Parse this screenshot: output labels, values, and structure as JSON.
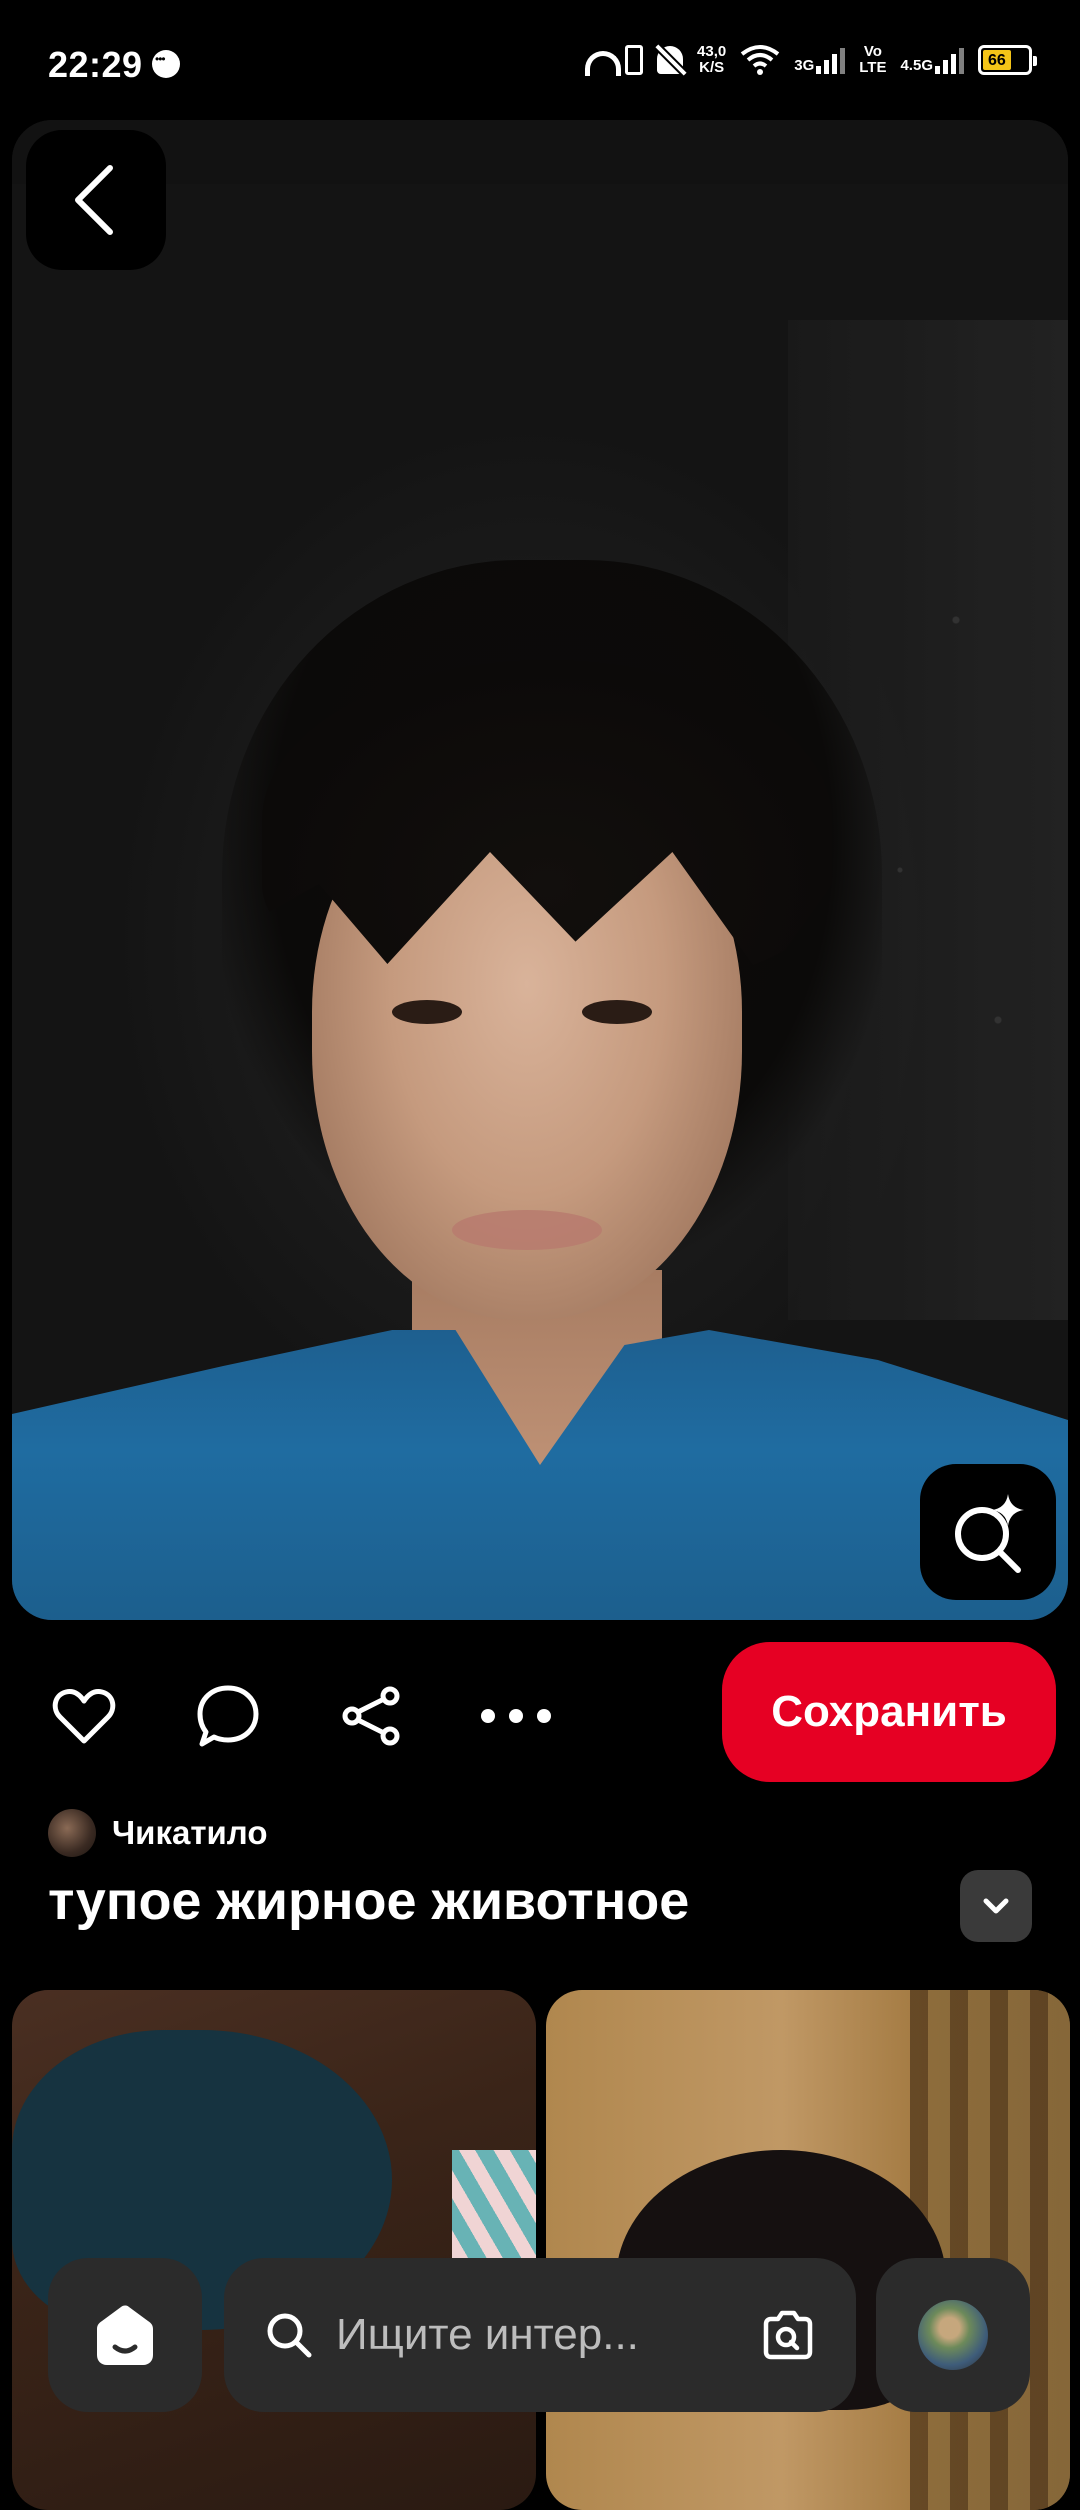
{
  "status_bar": {
    "time": "22:29",
    "speed_value": "43,0",
    "speed_unit": "K/S",
    "net_3g": "3G",
    "volte": "Vo",
    "volte_sub": "LTE",
    "net_45g": "4.5G",
    "battery_level": "66",
    "battery_color": "#f5c518"
  },
  "pin": {
    "back_icon": "chevron-left-icon",
    "visual_search_icon": "visual-search-sparkle-icon"
  },
  "actions": {
    "like_icon": "heart-icon",
    "comment_icon": "comment-bubble-icon",
    "share_icon": "share-icon",
    "more_icon": "more-dots-icon",
    "save_label": "Сохранить",
    "save_color": "#e60023"
  },
  "author": {
    "name": "Чикатило"
  },
  "title": "тупое жирное животное",
  "bottom_nav": {
    "home_icon": "home-icon",
    "search_placeholder": "Ищите интер...",
    "camera_icon": "camera-search-icon",
    "profile_icon": "profile-avatar"
  }
}
